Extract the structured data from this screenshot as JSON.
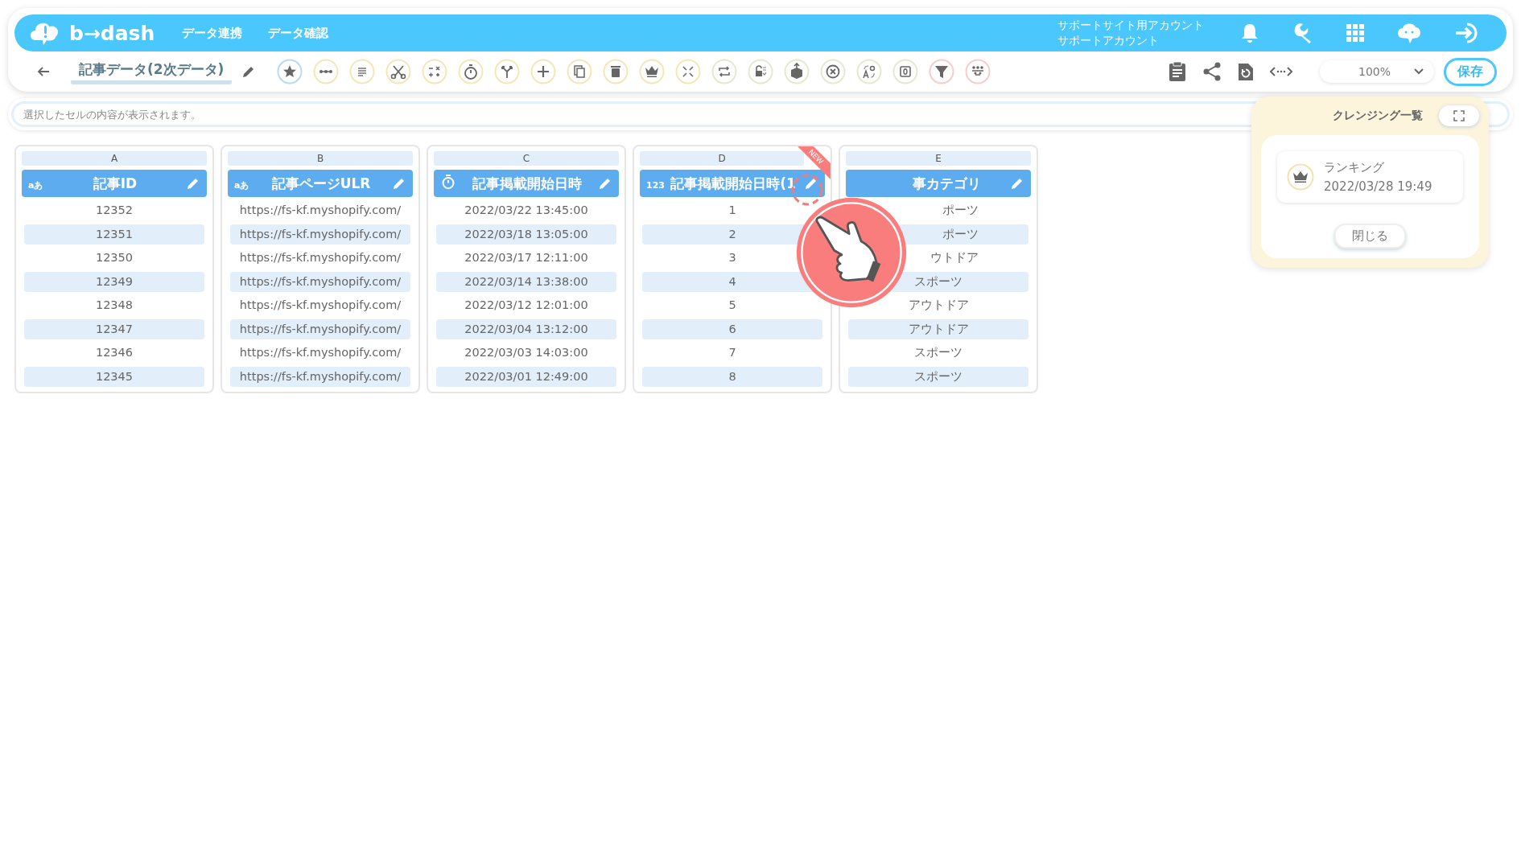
{
  "header": {
    "logo_text": "b→dash",
    "nav": [
      "データ連携",
      "データ確認"
    ],
    "account": [
      "サポートサイト用アカウント",
      "サポートアカウント"
    ]
  },
  "toolbar": {
    "title": "記事データ(2次データ)",
    "zoom": "100%",
    "save": "保存"
  },
  "formula_bar": {
    "placeholder": "選択したセルの内容が表示されます。"
  },
  "columns": [
    {
      "letter": "A",
      "kind": "text",
      "type_label": "aあ",
      "name": "記事ID",
      "cells": [
        "12352",
        "12351",
        "12350",
        "12349",
        "12348",
        "12347",
        "12346",
        "12345"
      ]
    },
    {
      "letter": "B",
      "kind": "text",
      "type_label": "aあ",
      "name": "記事ページULR",
      "cells": [
        "https://fs-kf.myshopify.com/",
        "https://fs-kf.myshopify.com/",
        "https://fs-kf.myshopify.com/",
        "https://fs-kf.myshopify.com/",
        "https://fs-kf.myshopify.com/",
        "https://fs-kf.myshopify.com/",
        "https://fs-kf.myshopify.com/",
        "https://fs-kf.myshopify.com/"
      ]
    },
    {
      "letter": "C",
      "kind": "time",
      "name": "記事掲載開始日時",
      "cells": [
        "2022/03/22 13:45:00",
        "2022/03/18 13:05:00",
        "2022/03/17 12:11:00",
        "2022/03/14 13:38:00",
        "2022/03/12 12:01:00",
        "2022/03/04 13:12:00",
        "2022/03/03 14:03:00",
        "2022/03/01 12:49:00"
      ]
    },
    {
      "letter": "D",
      "kind": "number",
      "type_label": "123",
      "name": "記事掲載開始日時(1",
      "ribbon": "NEW",
      "cells": [
        "1",
        "2",
        "3",
        "4",
        "5",
        "6",
        "7",
        "8"
      ]
    },
    {
      "letter": "E",
      "kind": "covered",
      "name": "事カテゴリ",
      "cells": [
        "ポーツ",
        "ポーツ",
        "ウトドア",
        "スポーツ",
        "アウトドア",
        "アウトドア",
        "スポーツ",
        "スポーツ"
      ]
    }
  ],
  "cleansing_panel": {
    "title": "クレンジング一覧",
    "items": [
      {
        "name": "ランキング",
        "date": "2022/03/28 19:49"
      }
    ],
    "close": "閉じる"
  }
}
